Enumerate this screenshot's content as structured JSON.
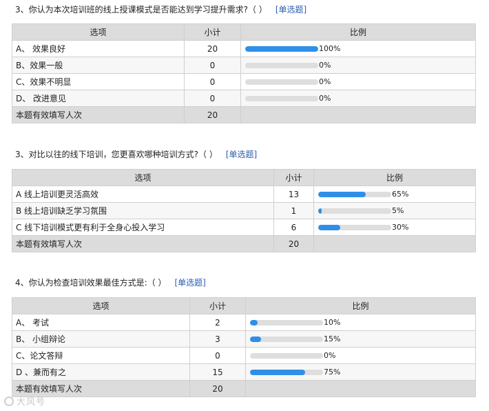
{
  "questions": [
    {
      "title": "3、你认为本次培训班的线上授课模式是否能达到学习提升需求?（  ）",
      "tag": "[单选题]",
      "headers": {
        "option": "选项",
        "count": "小计",
        "ratio": "比例"
      },
      "rows": [
        {
          "option": "A、  效果良好",
          "count": "20",
          "percent": "100%",
          "value": 1.0
        },
        {
          "option": "B、效果一般",
          "count": "0",
          "percent": "0%",
          "value": 0
        },
        {
          "option": "C、效果不明显",
          "count": "0",
          "percent": "0%",
          "value": 0
        },
        {
          "option": "D、   改进意见",
          "count": "0",
          "percent": "0%",
          "value": 0
        }
      ],
      "total": {
        "label": "本题有效填写人次",
        "count": "20"
      }
    },
    {
      "title": "3、对比以往的线下培训，您更喜欢哪种培训方式?（  ）",
      "tag": "[单选题]",
      "headers": {
        "option": "选项",
        "count": "小计",
        "ratio": "比例"
      },
      "rows": [
        {
          "option": "A 线上培训更灵活高效",
          "count": "13",
          "percent": "65%",
          "value": 0.65
        },
        {
          "option": "B 线上培训缺乏学习氛围",
          "count": "1",
          "percent": "5%",
          "value": 0.05
        },
        {
          "option": "C 线下培训模式更有利于全身心投入学习",
          "count": "6",
          "percent": "30%",
          "value": 0.3
        }
      ],
      "total": {
        "label": "本题有效填写人次",
        "count": "20"
      }
    },
    {
      "title": "4、你认为检查培训效果最佳方式是:（  ）",
      "tag": "[单选题]",
      "headers": {
        "option": "选项",
        "count": "小计",
        "ratio": "比例"
      },
      "rows": [
        {
          "option": "A、   考试",
          "count": "2",
          "percent": "10%",
          "value": 0.1
        },
        {
          "option": "B、   小组辩论",
          "count": "3",
          "percent": "15%",
          "value": 0.15
        },
        {
          "option": "C、论文答辩",
          "count": "0",
          "percent": "0%",
          "value": 0
        },
        {
          "option": "D 、兼而有之",
          "count": "15",
          "percent": "75%",
          "value": 0.75
        }
      ],
      "total": {
        "label": "本题有效填写人次",
        "count": "20"
      }
    }
  ],
  "watermark": "大风号",
  "colors": {
    "bar_fill": "#2f8fe8",
    "bar_track": "#dedede",
    "header_bg": "#dcdcdc",
    "tag": "#2a5db0"
  }
}
